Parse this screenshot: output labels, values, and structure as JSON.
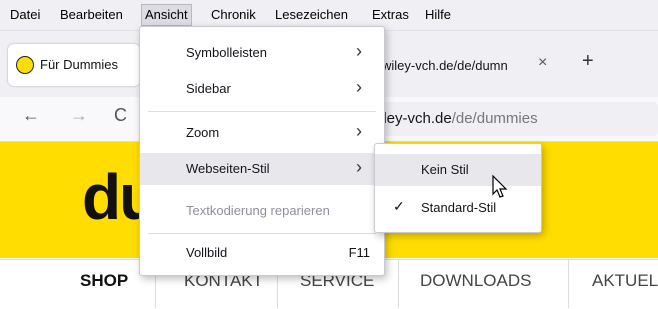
{
  "menubar": {
    "items": [
      "Datei",
      "Bearbeiten",
      "Ansicht",
      "Chronik",
      "Lesezeichen",
      "Extras",
      "Hilfe"
    ]
  },
  "tabs": {
    "active_title": "Für Dummies",
    "second_title": "wiley-vch.de/de/dumn",
    "close_glyph": "×",
    "new_tab_glyph": "+"
  },
  "nav": {
    "back_glyph": "←",
    "forward_glyph": "→",
    "reload_glyph": "C",
    "url_host": "iley-vch.de",
    "url_path": "/de/dummies"
  },
  "page": {
    "logo_text": "du",
    "nav_items": [
      "SHOP",
      "KONTAKT",
      "SERVICE",
      "DOWNLOADS",
      "AKTUEL"
    ]
  },
  "view_menu": {
    "items": [
      {
        "label": "Symbolleisten",
        "arrow": "›"
      },
      {
        "label": "Sidebar",
        "arrow": "›"
      },
      {
        "label": "Zoom",
        "arrow": "›"
      },
      {
        "label": "Webseiten-Stil",
        "arrow": "›"
      },
      {
        "label": "Textkodierung reparieren"
      },
      {
        "label": "Vollbild",
        "shortcut": "F11"
      }
    ]
  },
  "style_submenu": {
    "items": [
      {
        "label": "Kein Stil"
      },
      {
        "label": "Standard-Stil",
        "check": "✓"
      }
    ]
  },
  "colors": {
    "brand_yellow": "#ffdd00",
    "menu_highlight": "#e8e8ec"
  }
}
